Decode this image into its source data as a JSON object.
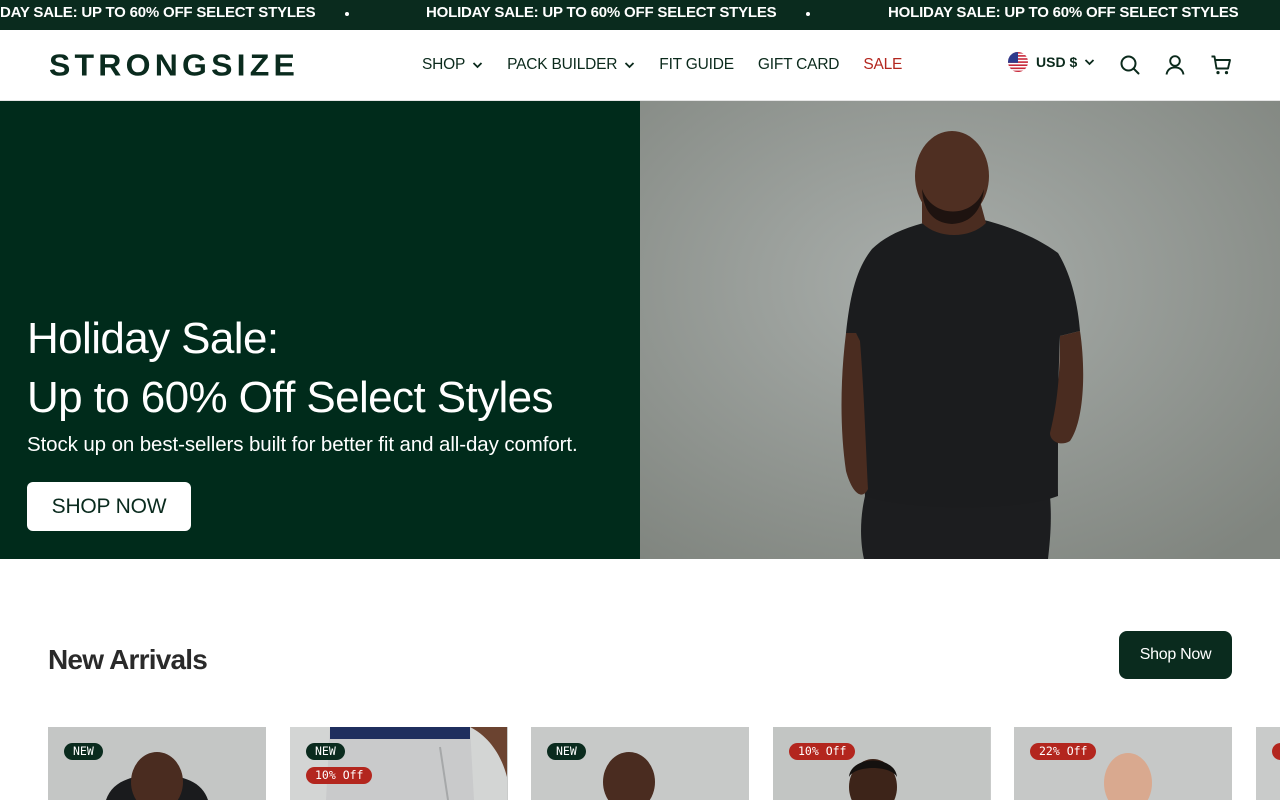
{
  "announcement": {
    "text": "HOLIDAY SALE: UP TO 60% OFF SELECT STYLES",
    "partial_text": "DAY SALE: UP TO 60% OFF SELECT STYLES"
  },
  "header": {
    "logo": "STRONGSIZE",
    "nav": [
      {
        "label": "SHOP",
        "dropdown": true
      },
      {
        "label": "PACK BUILDER",
        "dropdown": true
      },
      {
        "label": "FIT GUIDE",
        "dropdown": false
      },
      {
        "label": "GIFT CARD",
        "dropdown": false
      },
      {
        "label": "SALE",
        "dropdown": false
      }
    ],
    "currency": "USD $",
    "icons": [
      "us-flag-icon",
      "search-icon",
      "account-icon",
      "cart-icon"
    ]
  },
  "hero": {
    "title_line1": "Holiday Sale:",
    "title_line2": "Up to 60% Off Select Styles",
    "subtitle": "Stock up on best-sellers built for better fit and all-day comfort.",
    "button": "SHOP NOW"
  },
  "new_arrivals": {
    "title": "New Arrivals",
    "button": "Shop Now",
    "cards": [
      {
        "badges": [
          "NEW"
        ]
      },
      {
        "badges": [
          "NEW",
          "10% Off"
        ]
      },
      {
        "badges": [
          "NEW"
        ]
      },
      {
        "badges": [
          "10% Off"
        ]
      },
      {
        "badges": [
          "22% Off"
        ]
      }
    ]
  },
  "colors": {
    "brand_dark_green": "#0a2b1e",
    "hero_green": "#002b1b",
    "sale_red": "#b3261e"
  }
}
